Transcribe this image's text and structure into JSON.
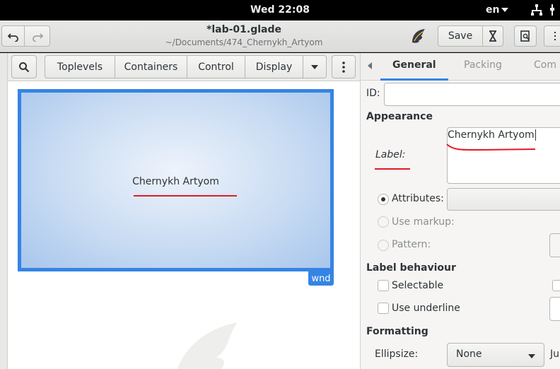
{
  "topbar": {
    "clock": "Wed 22:08",
    "language": "en"
  },
  "header": {
    "title": "*lab-01.glade",
    "subtitle": "~/Documents/474_Chernykh_Artyom",
    "save_label": "Save"
  },
  "palette": {
    "tabs": [
      "Toplevels",
      "Containers",
      "Control",
      "Display"
    ]
  },
  "canvas": {
    "window_label": "Chernykh Artyom",
    "window_badge": "wnd"
  },
  "editor": {
    "tabs": [
      "General",
      "Packing",
      "Com"
    ],
    "active_tab": "General",
    "id_label": "ID:",
    "id_value": "",
    "appearance_section": "Appearance",
    "label_label": "Label:",
    "label_value": "Chernykh Artyom",
    "attributes_label": "Attributes:",
    "use_markup_label": "Use markup:",
    "pattern_label": "Pattern:",
    "label_behaviour_section": "Label behaviour",
    "selectable_label": "Selectable",
    "use_underline_label": "Use underline",
    "formatting_section": "Formatting",
    "ellipsize_label": "Ellipsize:",
    "ellipsize_value": "None",
    "justify_partial": "Ju"
  },
  "colors": {
    "accent": "#3584e4",
    "annotation": "#e01b24"
  }
}
